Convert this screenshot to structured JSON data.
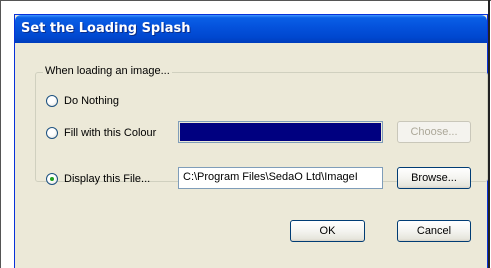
{
  "dialog": {
    "title": "Set the Loading Splash"
  },
  "group": {
    "legend": "When loading an image...",
    "options": [
      {
        "label": "Do Nothing",
        "checked": false
      },
      {
        "label": "Fill with this Colour",
        "checked": false
      },
      {
        "label": "Display this File...",
        "checked": true
      }
    ]
  },
  "colour": {
    "swatch": "#000080",
    "choose_label": "Choose..."
  },
  "file": {
    "path": "C:\\Program Files\\SedaO Ltd\\ImageI",
    "browse_label": "Browse..."
  },
  "buttons": {
    "ok_label": "OK",
    "cancel_label": "Cancel"
  },
  "colors": {
    "titlebar_blue": "#0553dd",
    "window_bg": "#ece9d8",
    "radio_dot_green": "#21a121"
  },
  "icons": {
    "radio": "radio-button-icon"
  }
}
